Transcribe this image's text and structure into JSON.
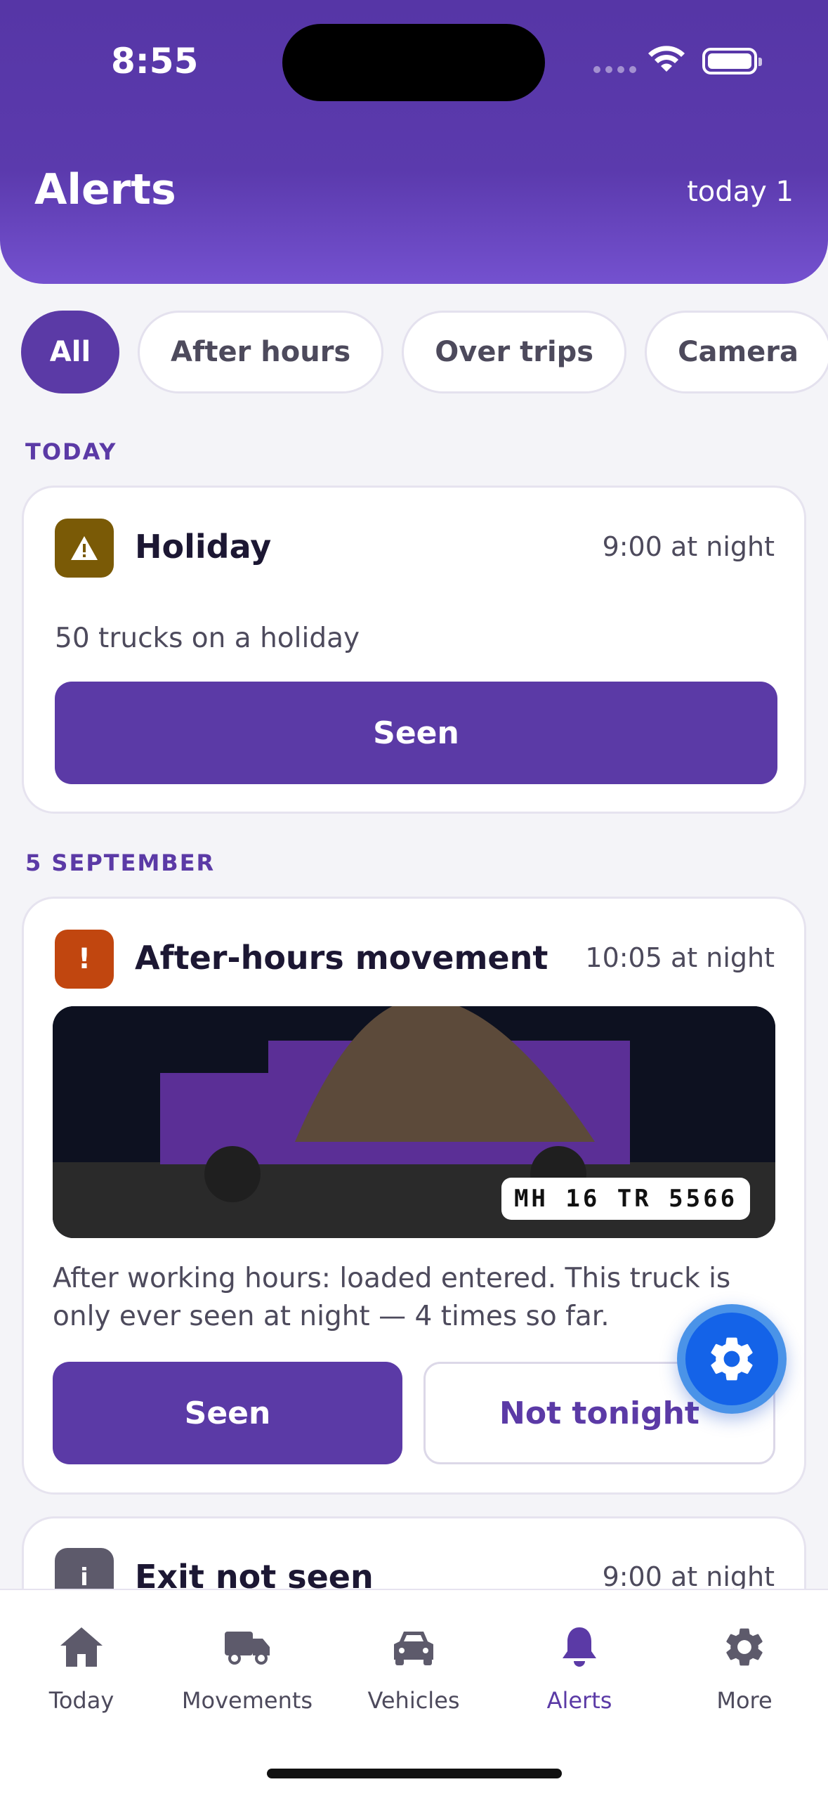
{
  "status_bar": {
    "time": "8:55"
  },
  "header": {
    "title": "Alerts",
    "today_count": "today 1"
  },
  "filters": [
    {
      "label": "All",
      "active": true
    },
    {
      "label": "After hours",
      "active": false
    },
    {
      "label": "Over trips",
      "active": false
    },
    {
      "label": "Camera",
      "active": false
    }
  ],
  "sections": {
    "today": "TODAY",
    "sep5": "5 SEPTEMBER"
  },
  "alerts": [
    {
      "icon": "warning-icon",
      "icon_color": "#7a5a06",
      "title": "Holiday",
      "time": "9:00 at night",
      "body": "50 trucks on a holiday",
      "primary": "Seen"
    },
    {
      "icon": "exclamation-icon",
      "icon_glyph": "!",
      "icon_color": "#c1460f",
      "title": "After-hours movement",
      "time": "10:05 at night",
      "plate": "MH 16 TR 5566",
      "body": "After working hours: loaded entered. This truck is only ever seen at night — 4 times so far.",
      "primary": "Seen",
      "secondary": "Not tonight"
    },
    {
      "icon": "info-icon",
      "icon_glyph": "i",
      "icon_color": "#5d5a6b",
      "title": "Exit not seen",
      "time": "9:00 at night"
    }
  ],
  "tabs": [
    {
      "label": "Today",
      "icon": "home-icon",
      "active": false
    },
    {
      "label": "Movements",
      "icon": "truck-icon",
      "active": false
    },
    {
      "label": "Vehicles",
      "icon": "car-icon",
      "active": false
    },
    {
      "label": "Alerts",
      "icon": "bell-icon",
      "active": true
    },
    {
      "label": "More",
      "icon": "gear-icon",
      "active": false
    }
  ],
  "colors": {
    "accent": "#5b3aa6",
    "fab": "#1463e8"
  }
}
